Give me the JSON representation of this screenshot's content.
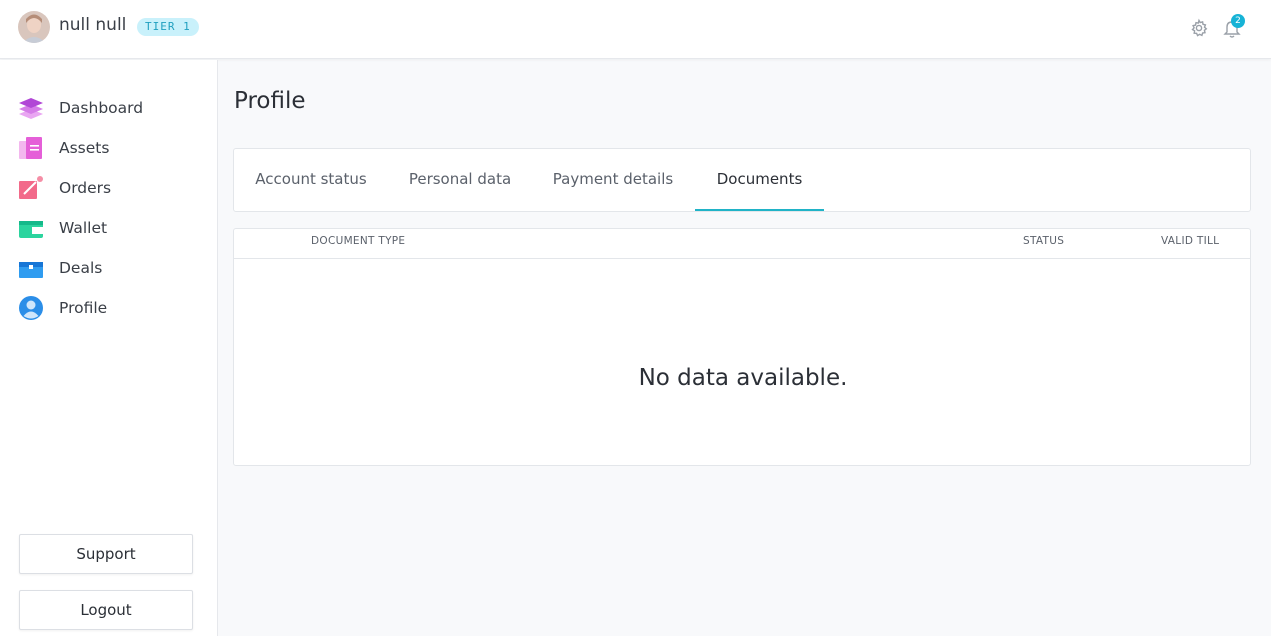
{
  "header": {
    "user_name": "null null",
    "tier_badge": "TIER 1",
    "notification_count": "2"
  },
  "sidebar": {
    "items": [
      {
        "label": "Dashboard",
        "icon": "layers-icon"
      },
      {
        "label": "Assets",
        "icon": "documents-icon"
      },
      {
        "label": "Orders",
        "icon": "order-icon"
      },
      {
        "label": "Wallet",
        "icon": "wallet-icon"
      },
      {
        "label": "Deals",
        "icon": "briefcase-icon"
      },
      {
        "label": "Profile",
        "icon": "user-icon"
      }
    ],
    "support_label": "Support",
    "logout_label": "Logout"
  },
  "main": {
    "page_title": "Profile",
    "tabs": [
      {
        "label": "Account status",
        "active": false
      },
      {
        "label": "Personal data",
        "active": false
      },
      {
        "label": "Payment details",
        "active": false
      },
      {
        "label": "Documents",
        "active": true
      }
    ],
    "table": {
      "columns": [
        "DOCUMENT TYPE",
        "STATUS",
        "VALID TILL"
      ],
      "empty_message": "No data available."
    }
  },
  "colors": {
    "accent": "#20b3c7",
    "badge_bg": "#c9f1fb",
    "badge_text": "#1f9fbf",
    "notification": "#17b3d6"
  }
}
